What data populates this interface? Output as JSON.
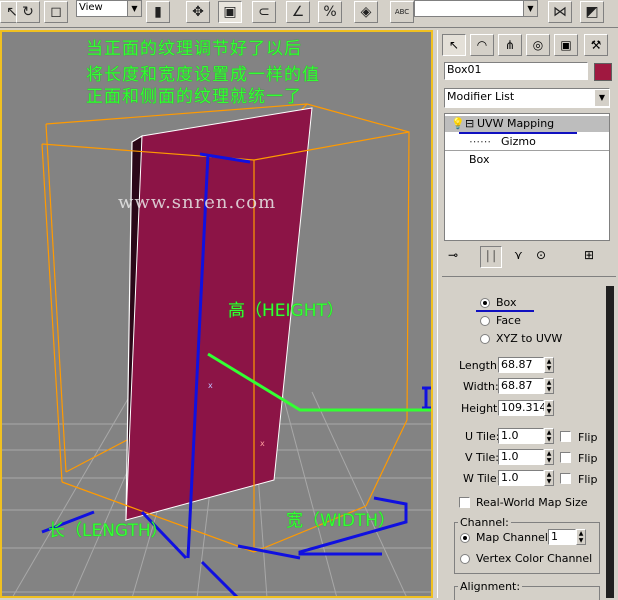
{
  "toolbar": {
    "view_label": "View",
    "abc_label": "ABC"
  },
  "viewport": {
    "annotation_lines": [
      "当正面的纹理调节好了以后",
      "将长度和宽度设置成一样的值",
      "正面和侧面的纹理就统一了"
    ],
    "watermark": "www.snren.com",
    "label_height": "高（HEIGHT）",
    "label_length": "长（LENGTH）",
    "label_width": "宽（WIDTH）"
  },
  "panel": {
    "object_name": "Box01",
    "object_color": "#a01840",
    "modifier_list": "Modifier List",
    "stack": [
      "UVW Mapping",
      "Gizmo",
      "Box"
    ],
    "mapping": {
      "options": [
        "Box",
        "Face",
        "XYZ to UVW"
      ],
      "selected": "Box"
    },
    "length_label": "Length:",
    "length_value": "68.87",
    "width_label": "Width:",
    "width_value": "68.87",
    "height_label": "Height:",
    "height_value": "109.314",
    "utile_label": "U Tile:",
    "utile_value": "1.0",
    "vtile_label": "V Tile:",
    "vtile_value": "1.0",
    "wtile_label": "W Tile:",
    "wtile_value": "1.0",
    "flip_label": "Flip",
    "realworld_label": "Real-World Map Size",
    "channel_title": "Channel:",
    "map_channel_label": "Map Channel:",
    "map_channel_value": "1",
    "vertex_color_label": "Vertex Color Channel",
    "alignment_title": "Alignment:"
  },
  "colors": {
    "box_face": "#8c1446",
    "box_edge": "#ff9a00",
    "annotation_green": "#33ff33",
    "annotation_blue": "#1010e0"
  }
}
